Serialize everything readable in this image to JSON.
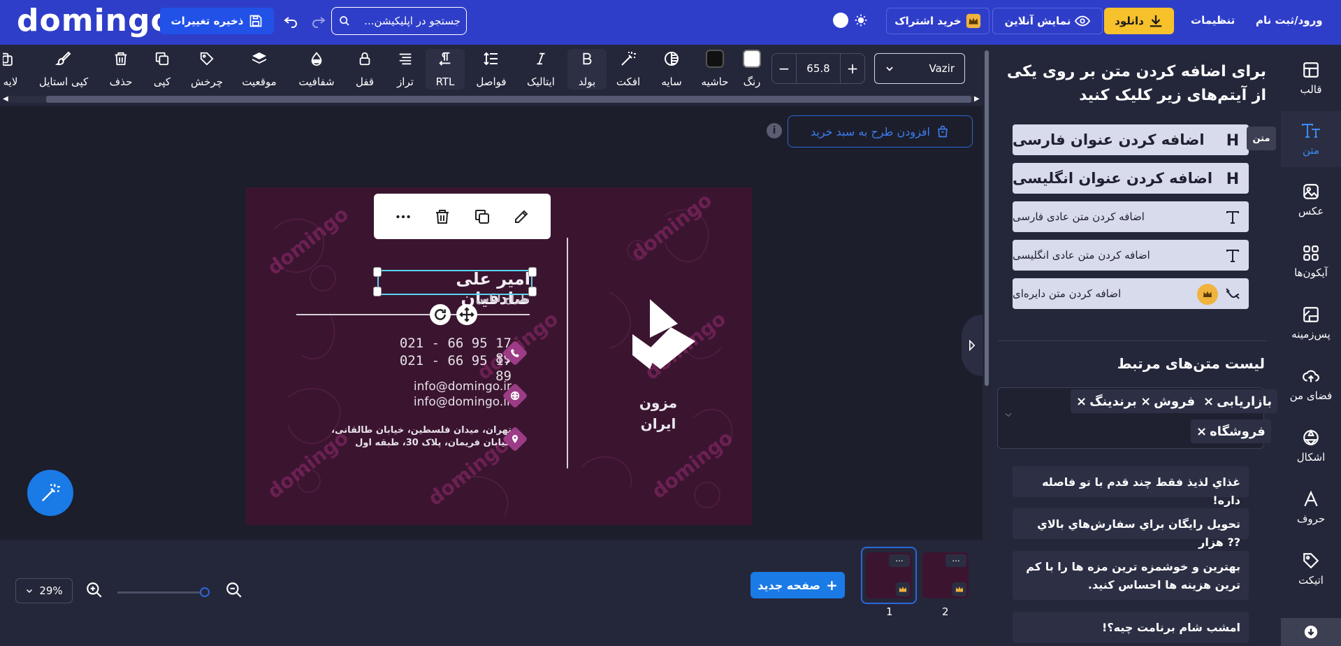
{
  "header": {
    "logo": "domingo",
    "save_label": "ذخیره تغییرات",
    "search_placeholder": "جستجو در اپلیکیشن...",
    "subscribe_label": "خرید اشتراک",
    "preview_label": "نمایش آنلاین",
    "download_label": "دانلود",
    "settings_label": "تنظیمات",
    "login_label": "ورود/ثبت نام"
  },
  "toolbar": {
    "font_family": "Vazir",
    "font_size": "65.8",
    "items": {
      "color": "رنگ",
      "border": "حاشیه",
      "shadow": "سایه",
      "effect": "افکت",
      "bold": "بولد",
      "italic": "ایتالیک",
      "spacing": "فواصل",
      "rtl": "RTL",
      "align": "تراز",
      "lock": "قفل",
      "opacity": "شفافیت",
      "position": "موقعیت",
      "rotate": "چرخش",
      "copy": "کپی",
      "delete": "حذف",
      "copy_style": "کپی استایل",
      "layers": "لایه"
    },
    "color_swatch": "#ffffff",
    "border_swatch": "#111111"
  },
  "canvas": {
    "add_to_cart": "افزودن طرح به سبد خرید",
    "card": {
      "name": "امیر علی صادقیان",
      "job_title": "طراح لباس",
      "phone_1": "021 - 66 95 17 89",
      "phone_2": "021 - 66 95 17 89",
      "email_1": "info@domingo.ir",
      "email_2": "info@domingo.ir",
      "address_1": "تهران، میدان فلسطین، خیابان طالقانی،",
      "address_2": "خیابان فریمان، پلاک 30، طبقه اول",
      "company_1": "مزون",
      "company_2": "ایران",
      "watermark": "domingo"
    }
  },
  "bottom": {
    "zoom": "29%",
    "new_page": "صفحه جدید",
    "pages": [
      "1",
      "2"
    ],
    "more": "..."
  },
  "panel": {
    "title": "برای اضافه کردن متن بر روی یکی از آیتم‌های زیر کلیک کنید",
    "add_buttons": [
      "اضافه کردن عنوان فارسی",
      "اضافه کردن عنوان انگلیسی",
      "اضافه کردن متن عادی فارسی",
      "اضافه کردن متن عادی انگلیسی",
      "اضافه کردن متن دایره‌ای"
    ],
    "related_title": "لیست متن‌های مرتبط",
    "tags": [
      "بازاریابی",
      "فروش",
      "برندینگ",
      "فروشگاه"
    ],
    "samples": [
      "غذاي لذيذ فقط چند قدم با تو فاصله داره!",
      "تحويل رايگان براي سفارش‌هاي بالاي ?? هزار",
      "بهترين و خوشمزه ترين مزه ها را با کم ترين هزينه ها احساس کنيد.",
      "امشب شام برنامت چيه؟!"
    ]
  },
  "sidebar": {
    "tooltip": "متن",
    "items": [
      "قالب",
      "متن",
      "عکس",
      "آیکون‌ها",
      "پس‌زمینه",
      "فضای من",
      "اشکال",
      "حروف",
      "اتیکت"
    ]
  },
  "colors": {
    "topbar": "#2f3ec9",
    "accent": "#1a7ae6",
    "download": "#f7c12b",
    "card_bg": "#3b1530",
    "selection": "#58d5ef"
  }
}
